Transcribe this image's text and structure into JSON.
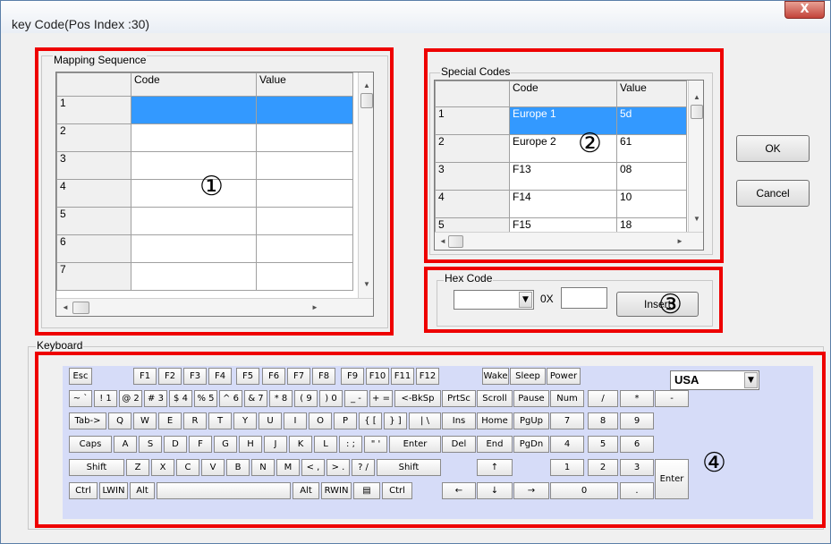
{
  "window": {
    "title": "key Code(Pos Index :30)",
    "close_glyph": "X"
  },
  "mapping": {
    "group_title": "Mapping Sequence",
    "headers": [
      "Code",
      "Value"
    ],
    "rows": [
      {
        "n": "1",
        "code": "",
        "value": ""
      },
      {
        "n": "2",
        "code": "",
        "value": ""
      },
      {
        "n": "3",
        "code": "",
        "value": ""
      },
      {
        "n": "4",
        "code": "",
        "value": ""
      },
      {
        "n": "5",
        "code": "",
        "value": ""
      },
      {
        "n": "6",
        "code": "",
        "value": ""
      },
      {
        "n": "7",
        "code": "",
        "value": ""
      }
    ]
  },
  "special": {
    "group_title": "Special Codes",
    "headers": [
      "Code",
      "Value"
    ],
    "rows": [
      {
        "n": "1",
        "code": "Europe 1",
        "value": "5d"
      },
      {
        "n": "2",
        "code": "Europe 2",
        "value": "61"
      },
      {
        "n": "3",
        "code": "F13",
        "value": "08"
      },
      {
        "n": "4",
        "code": "F14",
        "value": "10"
      },
      {
        "n": "5",
        "code": "F15",
        "value": "18"
      }
    ]
  },
  "hex": {
    "group_title": "Hex Code",
    "prefix": "0X",
    "insert_label": "Insert"
  },
  "buttons": {
    "ok": "OK",
    "cancel": "Cancel"
  },
  "keyboard": {
    "group_title": "Keyboard",
    "layout_selected": "USA"
  },
  "annotations": {
    "one": "①",
    "two": "②",
    "three": "③",
    "four": "④"
  },
  "colors": {
    "highlight": "#ee0000",
    "selection": "#3399ff",
    "keyboard_bg": "#d6dcf8"
  },
  "keys": [
    [
      "Esc",
      "F1",
      "F2",
      "F3",
      "F4",
      "F5",
      "F6",
      "F7",
      "F8",
      "F9",
      "F10",
      "F11",
      "F12",
      "Wake",
      "Sleep",
      "Power"
    ],
    [
      "~ `",
      "! 1",
      "@ 2",
      "# 3",
      "$ 4",
      "% 5",
      "^ 6",
      "& 7",
      "* 8",
      "( 9",
      ") 0",
      "_ -",
      "+ =",
      "<-BkSp",
      "PrtSc",
      "Scroll",
      "Pause",
      "Num",
      "/",
      "*",
      "-"
    ],
    [
      "Tab->",
      "Q",
      "W",
      "E",
      "R",
      "T",
      "Y",
      "U",
      "I",
      "O",
      "P",
      "{ [",
      "} ]",
      "| \\",
      "Ins",
      "Home",
      "PgUp",
      "7",
      "8",
      "9",
      "+"
    ],
    [
      "Caps",
      "A",
      "S",
      "D",
      "F",
      "G",
      "H",
      "J",
      "K",
      "L",
      ": ;",
      "\" '",
      "Enter",
      "Del",
      "End",
      "PgDn",
      "4",
      "5",
      "6"
    ],
    [
      "Shift",
      "Z",
      "X",
      "C",
      "V",
      "B",
      "N",
      "M",
      "< ,",
      "> .",
      "? /",
      "Shift",
      "↑",
      "1",
      "2",
      "3",
      "Enter"
    ],
    [
      "Ctrl",
      "LWIN",
      "Alt",
      "",
      "Alt",
      "RWIN",
      "menu-icon",
      "Ctrl",
      "←",
      "↓",
      "→",
      "0",
      "."
    ]
  ]
}
